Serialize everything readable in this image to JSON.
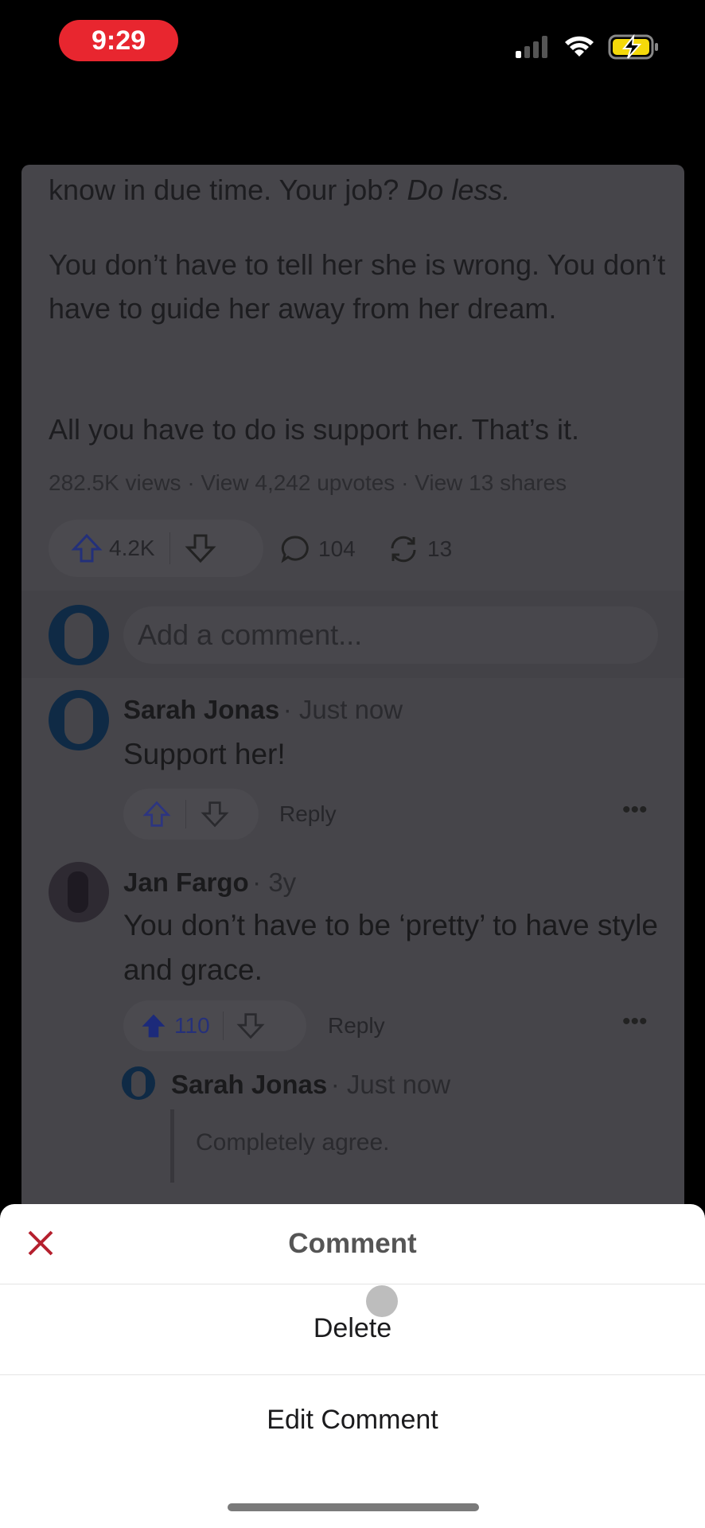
{
  "status_bar": {
    "time": "9:29",
    "signal": "cellular-signal-icon",
    "wifi": "wifi-icon",
    "battery": "battery-charging-icon",
    "battery_color": "#f5d90a"
  },
  "post": {
    "paragraphs": [
      {
        "text": "know in due time. Your job? ",
        "em": "Do less."
      },
      {
        "text": "You don’t have to tell her she is wrong. You don’t have to guide her away from her dream."
      },
      {
        "text": "All you have to do is support her. That’s it."
      }
    ],
    "stats": "282.5K views · View 4,242 upvotes · View 13 shares",
    "upvotes": "4.2K",
    "comments": "104",
    "shares": "13",
    "comment_placeholder": "Add a comment..."
  },
  "comments": [
    {
      "author": "Sarah Jonas",
      "time": "· Just now",
      "text": "Support her!",
      "reply": "Reply"
    },
    {
      "author": "Jan Fargo",
      "time": "· 3y",
      "text": "You don’t have to be ‘pretty’ to have style and grace.",
      "upvotes": "110",
      "reply": "Reply",
      "replies": [
        {
          "author": "Sarah Jonas",
          "time": "· Just now",
          "text": "Completely agree."
        }
      ]
    }
  ],
  "sheet": {
    "title": "Comment",
    "options": [
      "Delete",
      "Edit Comment"
    ],
    "close_color": "#b5202e"
  },
  "colors": {
    "accent": "#2b3bb5"
  }
}
